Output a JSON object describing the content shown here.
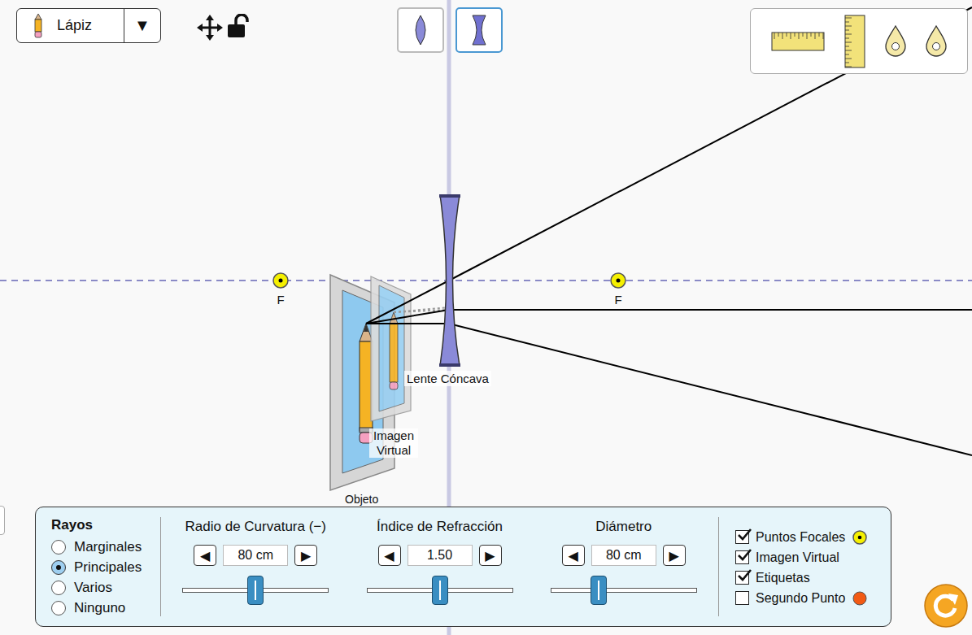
{
  "objectSelector": {
    "label": "Lápiz",
    "arrow": "▼"
  },
  "lensTypes": [
    {
      "kind": "convex",
      "selected": false
    },
    {
      "kind": "concave",
      "selected": true
    }
  ],
  "scene": {
    "focalPoints": [
      {
        "label": "F"
      },
      {
        "label": "F"
      }
    ],
    "lensLabel": "Lente Cóncava",
    "imageLabel": "Imagen Virtual",
    "objectLabel": "Objeto"
  },
  "rays": {
    "title": "Rayos",
    "options": [
      {
        "label": "Marginales",
        "selected": false
      },
      {
        "label": "Principales",
        "selected": true
      },
      {
        "label": "Varios",
        "selected": false
      },
      {
        "label": "Ninguno",
        "selected": false
      }
    ]
  },
  "arrows": {
    "decrement": "◀",
    "increment": "▶"
  },
  "numberControls": [
    {
      "label": "Radio de Curvatura (−)",
      "value": "80 cm",
      "level": 0.5
    },
    {
      "label": "Índice de Refracción",
      "value": "1.50",
      "level": 0.5
    },
    {
      "label": "Diámetro",
      "value": "80 cm",
      "level": 0.33
    }
  ],
  "checkboxes": [
    {
      "label": "Puntos Focales",
      "checked": true,
      "kind": "focal"
    },
    {
      "label": "Imagen Virtual",
      "checked": true,
      "kind": "plain"
    },
    {
      "label": "Etiquetas",
      "checked": true,
      "kind": "plain"
    },
    {
      "label": "Segundo Punto",
      "checked": false,
      "kind": "second-point"
    }
  ]
}
